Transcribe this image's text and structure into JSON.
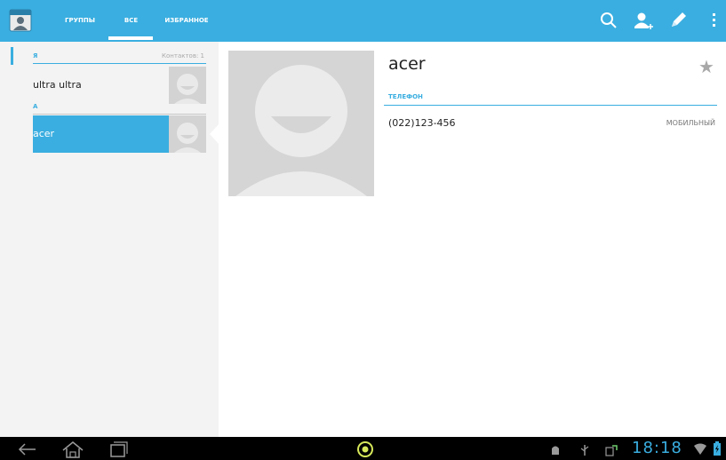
{
  "action_bar": {
    "app_icon": "contacts-app-icon",
    "tabs": [
      {
        "label": "ГРУППЫ",
        "selected": false
      },
      {
        "label": "ВСЕ",
        "selected": true
      },
      {
        "label": "ИЗБРАННОЕ",
        "selected": false
      }
    ],
    "actions": [
      "search-icon",
      "add-contact-icon",
      "edit-icon",
      "overflow-menu-icon"
    ]
  },
  "contact_list": {
    "sections": [
      {
        "header": "Я",
        "count": "Контактов: 1",
        "items": [
          {
            "name": "ultra ultra",
            "selected": false
          }
        ]
      },
      {
        "header": "А",
        "items": [
          {
            "name": "acer",
            "selected": true
          }
        ]
      }
    ]
  },
  "detail": {
    "name": "acer",
    "starred": false,
    "section_label": "ТЕЛЕФОН",
    "phone": {
      "number": "(022)123-456",
      "type": "МОБИЛЬНЫЙ"
    }
  },
  "system_bar": {
    "time": "18:18",
    "nav": [
      "back-icon",
      "home-icon",
      "recent-apps-icon"
    ],
    "status_icons": [
      "android-debug-icon",
      "usb-icon",
      "sync-icon",
      "wifi-icon",
      "battery-icon"
    ]
  },
  "colors": {
    "accent": "#3aaee0",
    "list_background": "#f3f3f3",
    "placeholder": "#d5d5d5"
  }
}
